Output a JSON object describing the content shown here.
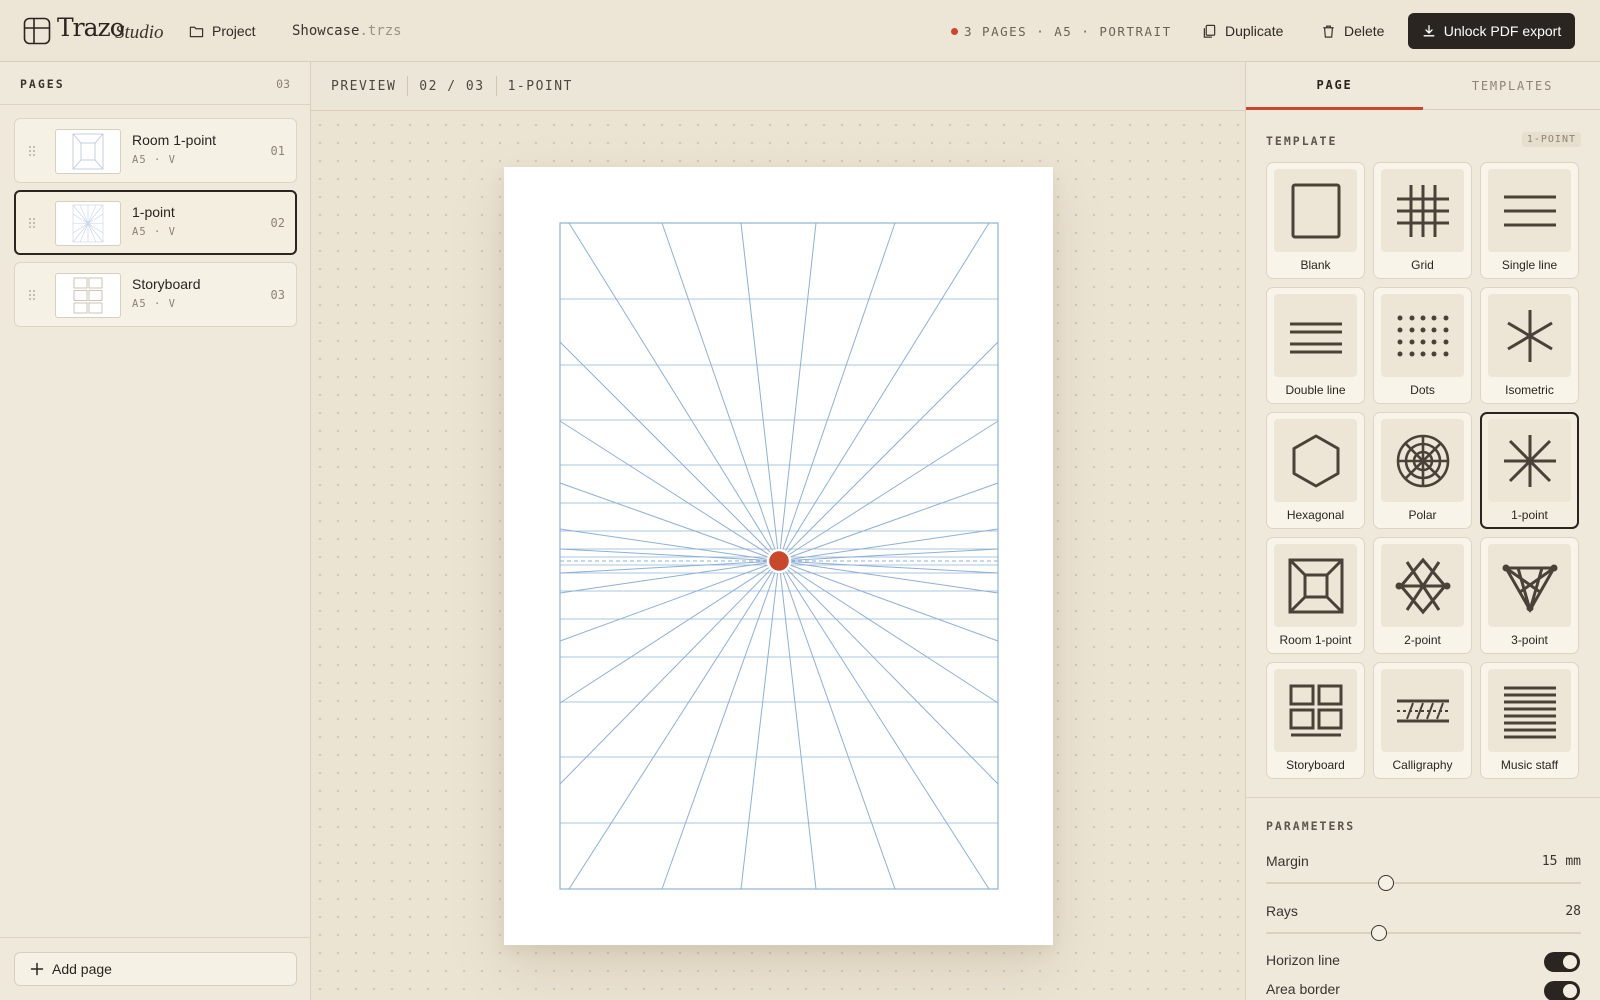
{
  "app": {
    "brand": "Trazo",
    "brand_sub": "Studio"
  },
  "topbar": {
    "project_label": "Project",
    "filename": "Showcase",
    "filename_ext": ".trzs",
    "meta": "3 PAGES · A5 · PORTRAIT",
    "duplicate_label": "Duplicate",
    "delete_label": "Delete",
    "unlock_label": "Unlock PDF export"
  },
  "sidebar": {
    "title": "PAGES",
    "count": "03",
    "pages": [
      {
        "name": "Room 1-point",
        "sub": "A5 · V",
        "num": "01",
        "thumb": "room-1-point"
      },
      {
        "name": "1-point",
        "sub": "A5 · V",
        "num": "02",
        "thumb": "1-point",
        "active": true
      },
      {
        "name": "Storyboard",
        "sub": "A5 · V",
        "num": "03",
        "thumb": "storyboard"
      }
    ],
    "add_page_label": "Add page"
  },
  "canvas": {
    "mode": "PREVIEW",
    "page_indicator": "02 / 03",
    "template": "1-POINT",
    "grid_color": "#8fb0d4",
    "vanishing_point_color": "#c9472b"
  },
  "panel": {
    "tabs": [
      {
        "label": "PAGE",
        "active": true
      },
      {
        "label": "TEMPLATES",
        "active": false
      }
    ],
    "template_section": "TEMPLATE",
    "template_badge": "1-POINT",
    "templates": [
      {
        "label": "Blank",
        "icon": "blank"
      },
      {
        "label": "Grid",
        "icon": "grid"
      },
      {
        "label": "Single line",
        "icon": "single-line"
      },
      {
        "label": "Double line",
        "icon": "double-line"
      },
      {
        "label": "Dots",
        "icon": "dots"
      },
      {
        "label": "Isometric",
        "icon": "isometric"
      },
      {
        "label": "Hexagonal",
        "icon": "hexagonal"
      },
      {
        "label": "Polar",
        "icon": "polar"
      },
      {
        "label": "1-point",
        "icon": "1-point",
        "active": true
      },
      {
        "label": "Room 1-point",
        "icon": "room-1-point"
      },
      {
        "label": "2-point",
        "icon": "2-point"
      },
      {
        "label": "3-point",
        "icon": "3-point"
      },
      {
        "label": "Storyboard",
        "icon": "storyboard"
      },
      {
        "label": "Calligraphy",
        "icon": "calligraphy"
      },
      {
        "label": "Music staff",
        "icon": "music-staff"
      }
    ],
    "params_title": "PARAMETERS",
    "margin": {
      "label": "Margin",
      "value": "15",
      "unit": "mm",
      "fraction": 0.38
    },
    "rays": {
      "label": "Rays",
      "value": "28",
      "fraction": 0.36
    },
    "horizon_line": {
      "label": "Horizon line",
      "on": true
    },
    "area_border": {
      "label": "Area border",
      "on": true
    }
  }
}
